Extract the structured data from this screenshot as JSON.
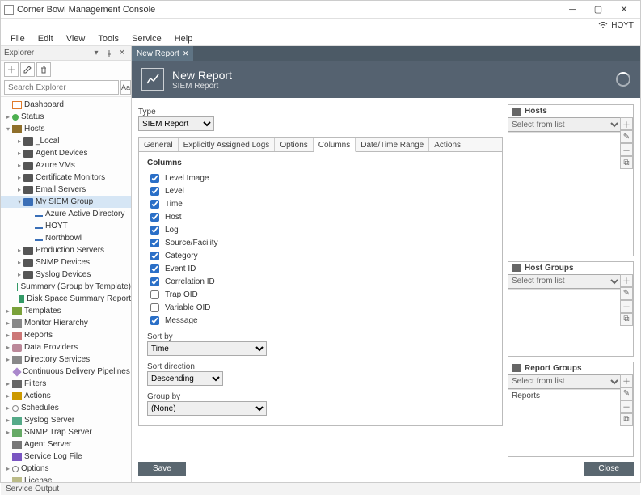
{
  "title": "Corner Bowl Management Console",
  "connection_label": "HOYT",
  "menu": [
    "File",
    "Edit",
    "View",
    "Tools",
    "Service",
    "Help"
  ],
  "explorer": {
    "title": "Explorer",
    "search_placeholder": "Search Explorer",
    "aa_label": "Aa",
    "tree": [
      {
        "ind": 0,
        "tw": "",
        "icon": "ic-dash",
        "label": "Dashboard"
      },
      {
        "ind": 0,
        "tw": "▸",
        "icon": "ic-dot-green",
        "label": "Status"
      },
      {
        "ind": 0,
        "tw": "▾",
        "icon": "ic-chip",
        "label": "Hosts"
      },
      {
        "ind": 1,
        "tw": "▸",
        "icon": "ic-folder",
        "label": "_Local"
      },
      {
        "ind": 1,
        "tw": "▸",
        "icon": "ic-folder",
        "label": "Agent Devices"
      },
      {
        "ind": 1,
        "tw": "▸",
        "icon": "ic-folder",
        "label": "Azure VMs"
      },
      {
        "ind": 1,
        "tw": "▸",
        "icon": "ic-folder",
        "label": "Certificate Monitors"
      },
      {
        "ind": 1,
        "tw": "▸",
        "icon": "ic-folder",
        "label": "Email Servers"
      },
      {
        "ind": 1,
        "tw": "▾",
        "icon": "ic-folder blue",
        "label": "My SIEM Group",
        "sel": true
      },
      {
        "ind": 2,
        "tw": "",
        "icon": "ic-host",
        "label": "Azure Active Directory"
      },
      {
        "ind": 2,
        "tw": "",
        "icon": "ic-host",
        "label": "HOYT"
      },
      {
        "ind": 2,
        "tw": "",
        "icon": "ic-host",
        "label": "Northbowl"
      },
      {
        "ind": 1,
        "tw": "▸",
        "icon": "ic-folder",
        "label": "Production Servers"
      },
      {
        "ind": 1,
        "tw": "▸",
        "icon": "ic-folder",
        "label": "SNMP Devices"
      },
      {
        "ind": 1,
        "tw": "▸",
        "icon": "ic-folder",
        "label": "Syslog Devices"
      },
      {
        "ind": 1,
        "tw": "",
        "icon": "ic-bar",
        "label": "Summary (Group by Template)"
      },
      {
        "ind": 1,
        "tw": "",
        "icon": "ic-bar",
        "label": "Disk Space Summary Report"
      },
      {
        "ind": 0,
        "tw": "▸",
        "icon": "ic-tpl",
        "label": "Templates"
      },
      {
        "ind": 0,
        "tw": "▸",
        "icon": "ic-generic",
        "label": "Monitor Hierarchy"
      },
      {
        "ind": 0,
        "tw": "▸",
        "icon": "ic-rep",
        "label": "Reports"
      },
      {
        "ind": 0,
        "tw": "▸",
        "icon": "ic-db",
        "label": "Data Providers"
      },
      {
        "ind": 0,
        "tw": "▸",
        "icon": "ic-generic",
        "label": "Directory Services"
      },
      {
        "ind": 0,
        "tw": "",
        "icon": "ic-diamond",
        "label": "Continuous Delivery Pipelines"
      },
      {
        "ind": 0,
        "tw": "▸",
        "icon": "ic-funnel",
        "label": "Filters"
      },
      {
        "ind": 0,
        "tw": "▸",
        "icon": "ic-bolt",
        "label": "Actions"
      },
      {
        "ind": 0,
        "tw": "▸",
        "icon": "ic-clock",
        "label": "Schedules"
      },
      {
        "ind": 0,
        "tw": "▸",
        "icon": "ic-syslog",
        "label": "Syslog Server"
      },
      {
        "ind": 0,
        "tw": "▸",
        "icon": "ic-snmp",
        "label": "SNMP Trap Server"
      },
      {
        "ind": 0,
        "tw": "",
        "icon": "ic-agentsrv",
        "label": "Agent Server"
      },
      {
        "ind": 0,
        "tw": "",
        "icon": "ic-logfile",
        "label": "Service Log File"
      },
      {
        "ind": 0,
        "tw": "▸",
        "icon": "ic-gear",
        "label": "Options"
      },
      {
        "ind": 0,
        "tw": "",
        "icon": "ic-key",
        "label": "License"
      }
    ]
  },
  "doc": {
    "tab_label": "New Report",
    "banner_title": "New Report",
    "banner_subtitle": "SIEM Report",
    "type_label": "Type",
    "type_value": "SIEM Report",
    "tabs": [
      "General",
      "Explicitly Assigned Logs",
      "Options",
      "Columns",
      "Date/Time Range",
      "Actions"
    ],
    "active_tab": "Columns",
    "columns_title": "Columns",
    "columns": [
      {
        "label": "Level Image",
        "checked": true
      },
      {
        "label": "Level",
        "checked": true
      },
      {
        "label": "Time",
        "checked": true
      },
      {
        "label": "Host",
        "checked": true
      },
      {
        "label": "Log",
        "checked": true
      },
      {
        "label": "Source/Facility",
        "checked": true
      },
      {
        "label": "Category",
        "checked": true
      },
      {
        "label": "Event ID",
        "checked": true
      },
      {
        "label": "Correlation ID",
        "checked": true
      },
      {
        "label": "Trap OID",
        "checked": false
      },
      {
        "label": "Variable OID",
        "checked": false
      },
      {
        "label": "Message",
        "checked": true
      }
    ],
    "sortby_label": "Sort by",
    "sortby_value": "Time",
    "sortdir_label": "Sort direction",
    "sortdir_value": "Descending",
    "groupby_label": "Group by",
    "groupby_value": "(None)",
    "save_label": "Save",
    "close_label": "Close"
  },
  "side": {
    "hosts": {
      "title": "Hosts",
      "placeholder": "Select from list"
    },
    "hostgroups": {
      "title": "Host Groups",
      "placeholder": "Select from list"
    },
    "reportgroups": {
      "title": "Report Groups",
      "placeholder": "Select from list",
      "items": [
        "Reports"
      ]
    }
  },
  "status": "Service Output"
}
